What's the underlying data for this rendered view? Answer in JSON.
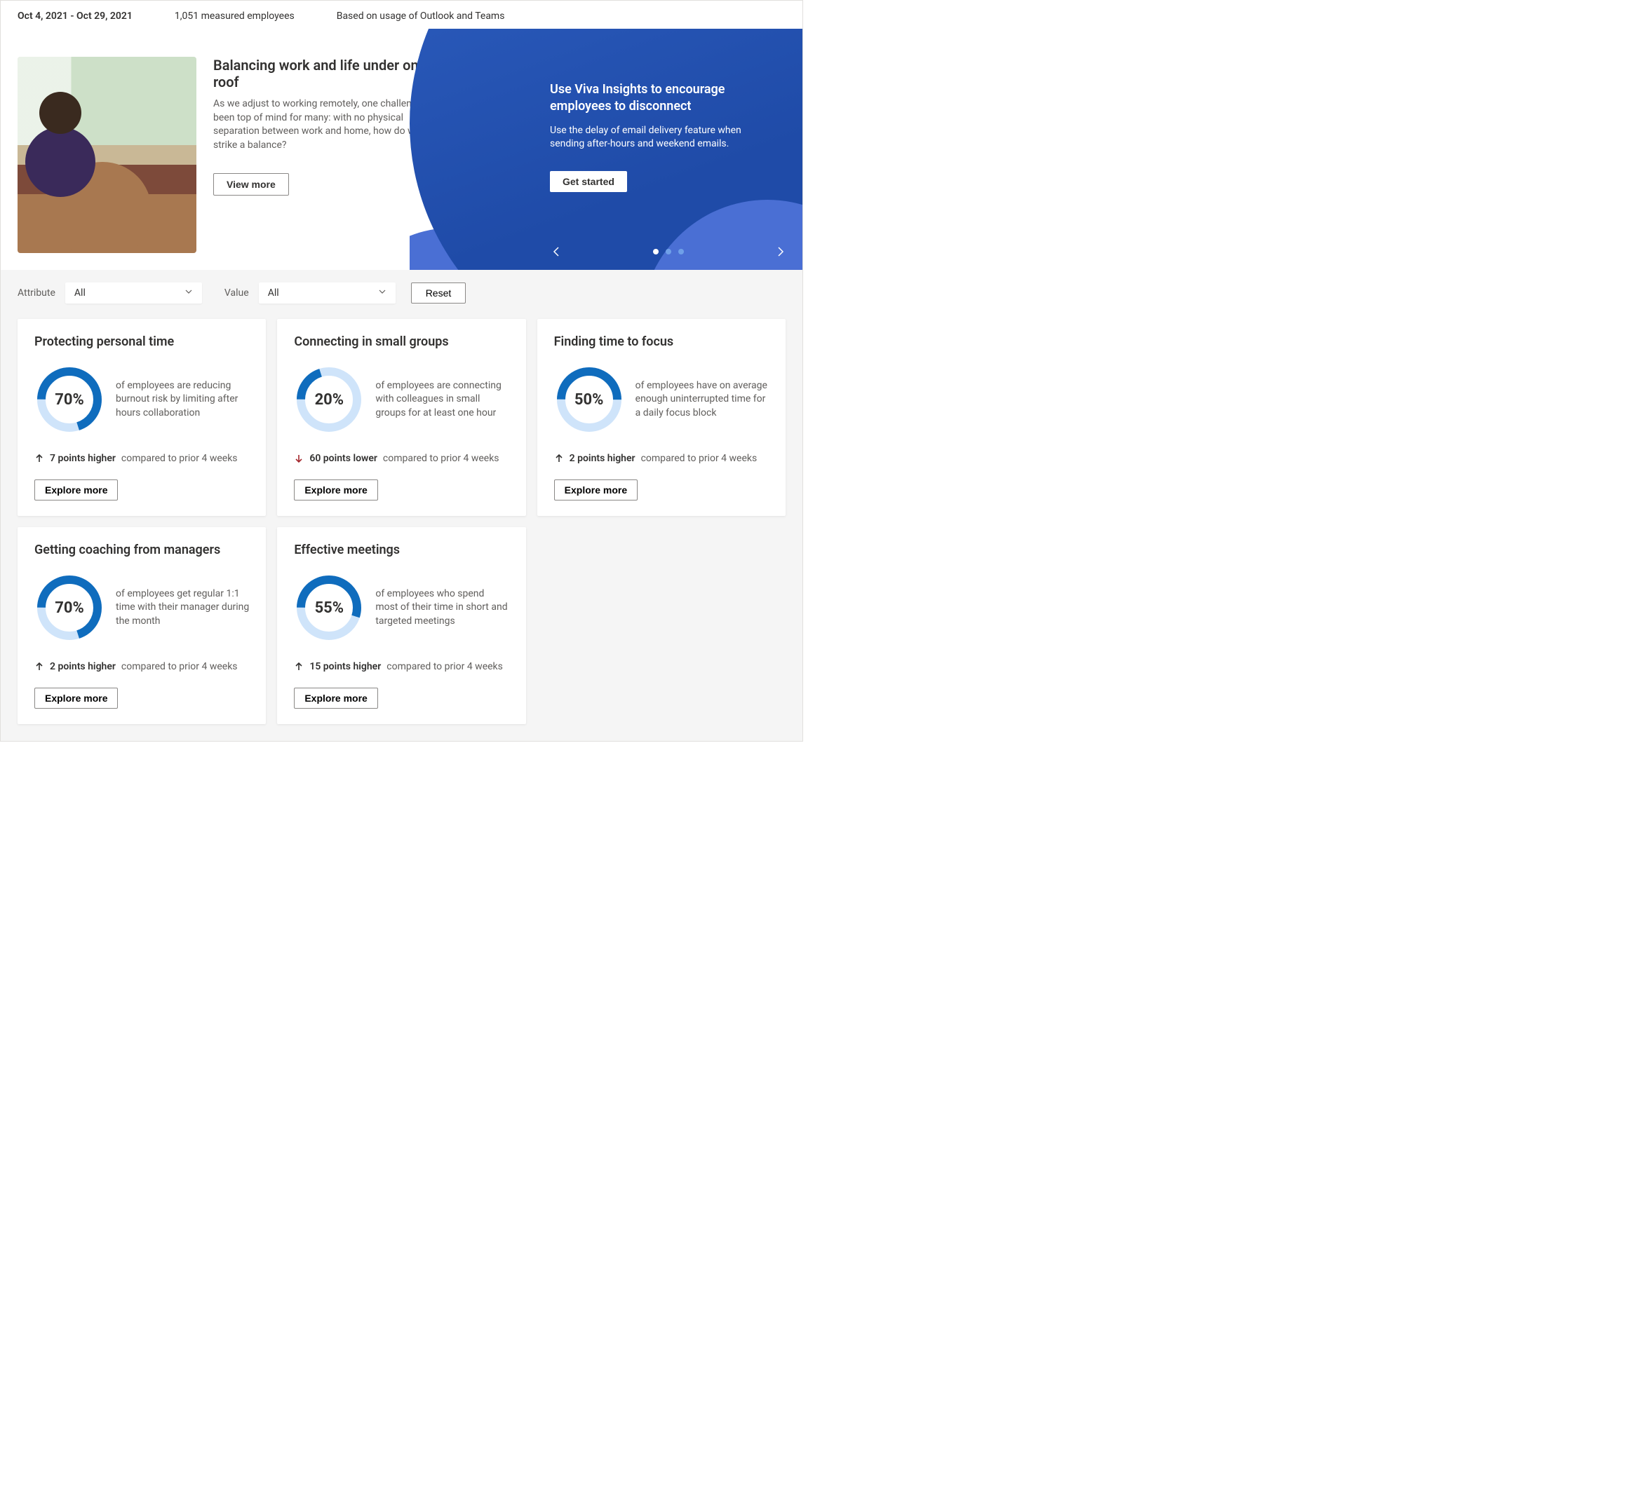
{
  "header": {
    "date_range": "Oct 4, 2021 - Oct 29, 2021",
    "employees": "1,051 measured employees",
    "source": "Based on usage of Outlook and Teams"
  },
  "hero": {
    "title": "Balancing work and life under one roof",
    "body": "As we adjust to working remotely, one challenge has been top of mind for many: with no physical separation between work and home, how do we strike a balance?",
    "view_more": "View more"
  },
  "promo": {
    "title": "Use Viva Insights to encourage employees to disconnect",
    "body": "Use the delay of email delivery feature when sending after-hours and weekend emails.",
    "cta": "Get started"
  },
  "filters": {
    "attribute_label": "Attribute",
    "attribute_value": "All",
    "value_label": "Value",
    "value_value": "All",
    "reset": "Reset"
  },
  "cards": [
    {
      "title": "Protecting personal time",
      "pct": 70,
      "pct_label": "70%",
      "desc": "of employees are reducing burnout risk by limiting after hours collaboration",
      "trend_dir": "up",
      "trend_value": "7 points higher",
      "trend_context": "compared to prior 4 weeks",
      "explore": "Explore more"
    },
    {
      "title": "Connecting in small groups",
      "pct": 20,
      "pct_label": "20%",
      "desc": "of employees are connecting with colleagues in small groups for at least one hour",
      "trend_dir": "down",
      "trend_value": "60 points lower",
      "trend_context": "compared to prior 4 weeks",
      "explore": "Explore more"
    },
    {
      "title": "Finding time to focus",
      "pct": 50,
      "pct_label": "50%",
      "desc": "of employees have on average enough uninterrupted time for a daily focus block",
      "trend_dir": "up",
      "trend_value": "2 points higher",
      "trend_context": "compared to prior 4 weeks",
      "explore": "Explore more"
    },
    {
      "title": "Getting coaching from managers",
      "pct": 70,
      "pct_label": "70%",
      "desc": "of employees get regular 1:1 time with their manager during the month",
      "trend_dir": "up",
      "trend_value": "2 points higher",
      "trend_context": "compared to prior 4 weeks",
      "explore": "Explore more"
    },
    {
      "title": "Effective meetings",
      "pct": 55,
      "pct_label": "55%",
      "desc": "of employees who spend most of their time in short and targeted meetings",
      "trend_dir": "up",
      "trend_value": "15 points higher",
      "trend_context": "compared to prior 4 weeks",
      "explore": "Explore more"
    }
  ],
  "colors": {
    "donut_fill": "#0f6cbd",
    "donut_track": "#cfe4fa",
    "down": "#a4262c"
  },
  "chart_data": [
    {
      "type": "pie",
      "title": "Protecting personal time",
      "values": [
        70,
        30
      ]
    },
    {
      "type": "pie",
      "title": "Connecting in small groups",
      "values": [
        20,
        80
      ]
    },
    {
      "type": "pie",
      "title": "Finding time to focus",
      "values": [
        50,
        50
      ]
    },
    {
      "type": "pie",
      "title": "Getting coaching from managers",
      "values": [
        70,
        30
      ]
    },
    {
      "type": "pie",
      "title": "Effective meetings",
      "values": [
        55,
        45
      ]
    }
  ]
}
